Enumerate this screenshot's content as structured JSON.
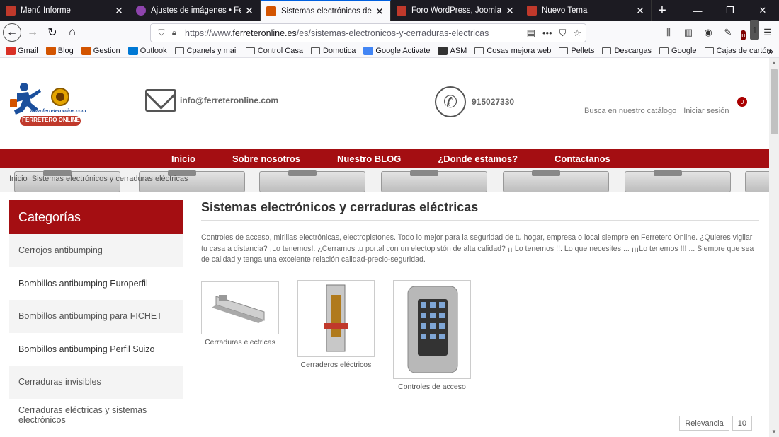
{
  "browser": {
    "tabs": [
      {
        "title": "Menú Informe",
        "favicon_color": "#c0392b"
      },
      {
        "title": "Ajustes de imágenes • Ferreteronline",
        "favicon_color": "#8e44ad"
      },
      {
        "title": "Sistemas electrónicos de alta",
        "favicon_color": "#d35400"
      },
      {
        "title": "Foro WordPress, Joomla y Pr",
        "favicon_color": "#c0392b"
      },
      {
        "title": "Nuevo Tema",
        "favicon_color": "#c0392b"
      }
    ],
    "url_prefix": "https://www.",
    "url_domain": "ferreteronline.es",
    "url_path": "/es/sistemas-electronicos-y-cerraduras-electricas",
    "ublock_count": "1",
    "bookmarks": [
      {
        "label": "Gmail",
        "type": "site",
        "color": "#d93025"
      },
      {
        "label": "Blog",
        "type": "site",
        "color": "#d35400"
      },
      {
        "label": "Gestion",
        "type": "site",
        "color": "#d35400"
      },
      {
        "label": "Outlook",
        "type": "site",
        "color": "#0078d4"
      },
      {
        "label": "Cpanels y mail",
        "type": "folder"
      },
      {
        "label": "Control Casa",
        "type": "folder"
      },
      {
        "label": "Domotica",
        "type": "folder"
      },
      {
        "label": "Google Activate",
        "type": "site",
        "color": "#4285f4"
      },
      {
        "label": "ASM",
        "type": "site",
        "color": "#333333"
      },
      {
        "label": "Cosas mejora web",
        "type": "folder"
      },
      {
        "label": "Pellets",
        "type": "folder"
      },
      {
        "label": "Descargas",
        "type": "folder"
      },
      {
        "label": "Google",
        "type": "folder"
      },
      {
        "label": "Cajas de cartón",
        "type": "folder"
      }
    ]
  },
  "site": {
    "logo_text": "www.ferreteronline.com",
    "logo_brand": "FERRETERO ONLINE",
    "email": "info@ferreteronline.com",
    "phone": "915027330",
    "search_link": "Busca en nuestro catálogo",
    "login_link": "Iniciar sesión",
    "cart_count": "0",
    "brand_color": "#a40e12",
    "nav": [
      "Inicio",
      "Sobre nosotros",
      "Nuestro BLOG",
      "¿Donde estamos?",
      "Contactanos"
    ],
    "breadcrumb": [
      "Inicio",
      "Sistemas electrónicos y cerraduras eléctricas"
    ]
  },
  "sidebar": {
    "title": "Categorías",
    "items": [
      "Cerrojos antibumping",
      "Bombillos antibumping Europerfil",
      "Bombillos antibumping para FICHET",
      "Bombillos antibumping Perfil Suizo",
      "Cerraduras invisibles",
      "Cerraduras eléctricas y sistemas electrónicos"
    ]
  },
  "content": {
    "title": "Sistemas electrónicos y cerraduras eléctricas",
    "description": "Controles de acceso, mirillas electrónicas, electropistones. Todo lo mejor para la seguridad de tu hogar, empresa o local siempre en Ferretero Online. ¿Quieres vigilar tu casa a distancia? ¡Lo tenemos!. ¿Cerramos tu portal con un electopistón de alta calidad? ¡¡ Lo tenemos !!. Lo que necesites ... ¡¡¡Lo tenemos !!! ... Siempre que sea de calidad y tenga una excelente relación calidad-precio-seguridad.",
    "subcategories": [
      {
        "label": "Cerraduras electricas"
      },
      {
        "label": "Cerraderos eléctricos"
      },
      {
        "label": "Controles de acceso"
      }
    ],
    "sort_label": "Relevancia",
    "per_page": "10"
  }
}
